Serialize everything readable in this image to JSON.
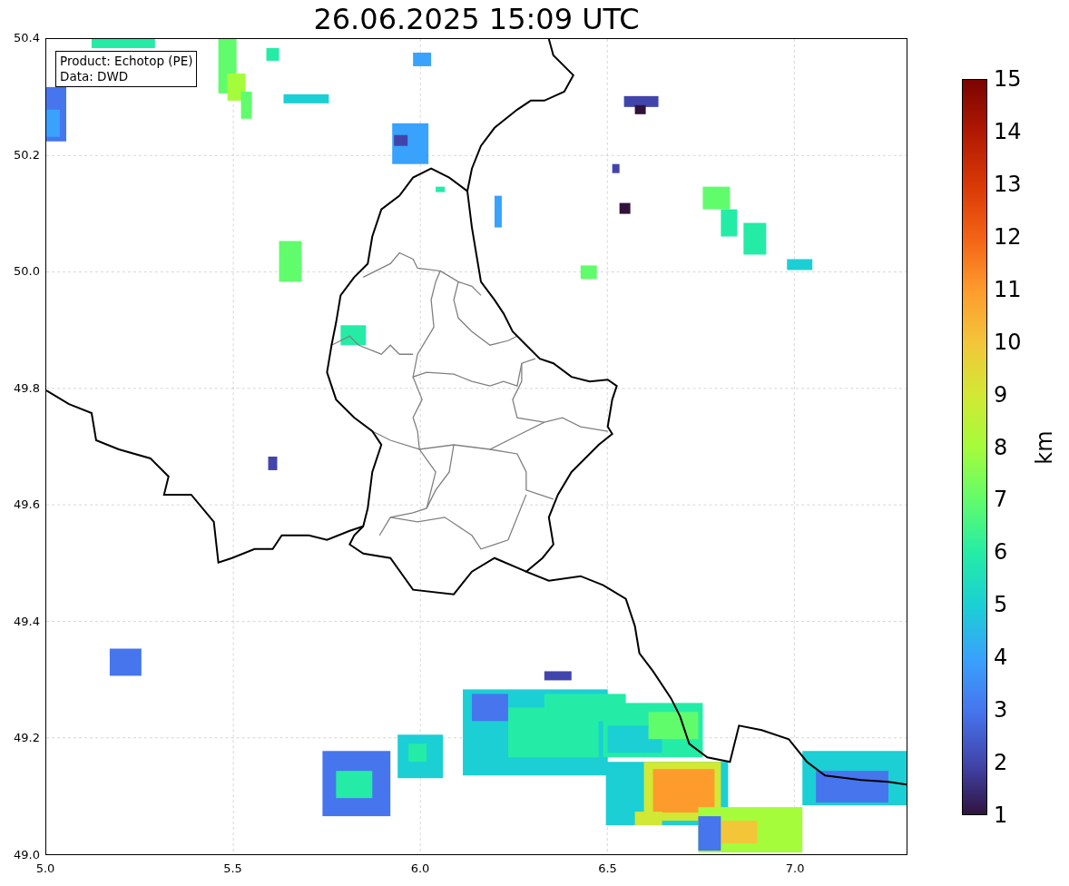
{
  "title": "26.06.2025 15:09 UTC",
  "info_box": [
    "Product: Echotop (PE)",
    "Data: DWD"
  ],
  "x_ticks": [
    "5.0",
    "5.5",
    "6.0",
    "6.5",
    "7.0"
  ],
  "y_ticks": [
    "50.4",
    "50.2",
    "50.0",
    "49.8",
    "49.6",
    "49.4",
    "49.2",
    "49.0"
  ],
  "colorbar": {
    "label": "km",
    "ticks": [
      "15",
      "14",
      "13",
      "12",
      "11",
      "10",
      "9",
      "8",
      "7",
      "6",
      "5",
      "4",
      "3",
      "2",
      "1"
    ]
  }
}
